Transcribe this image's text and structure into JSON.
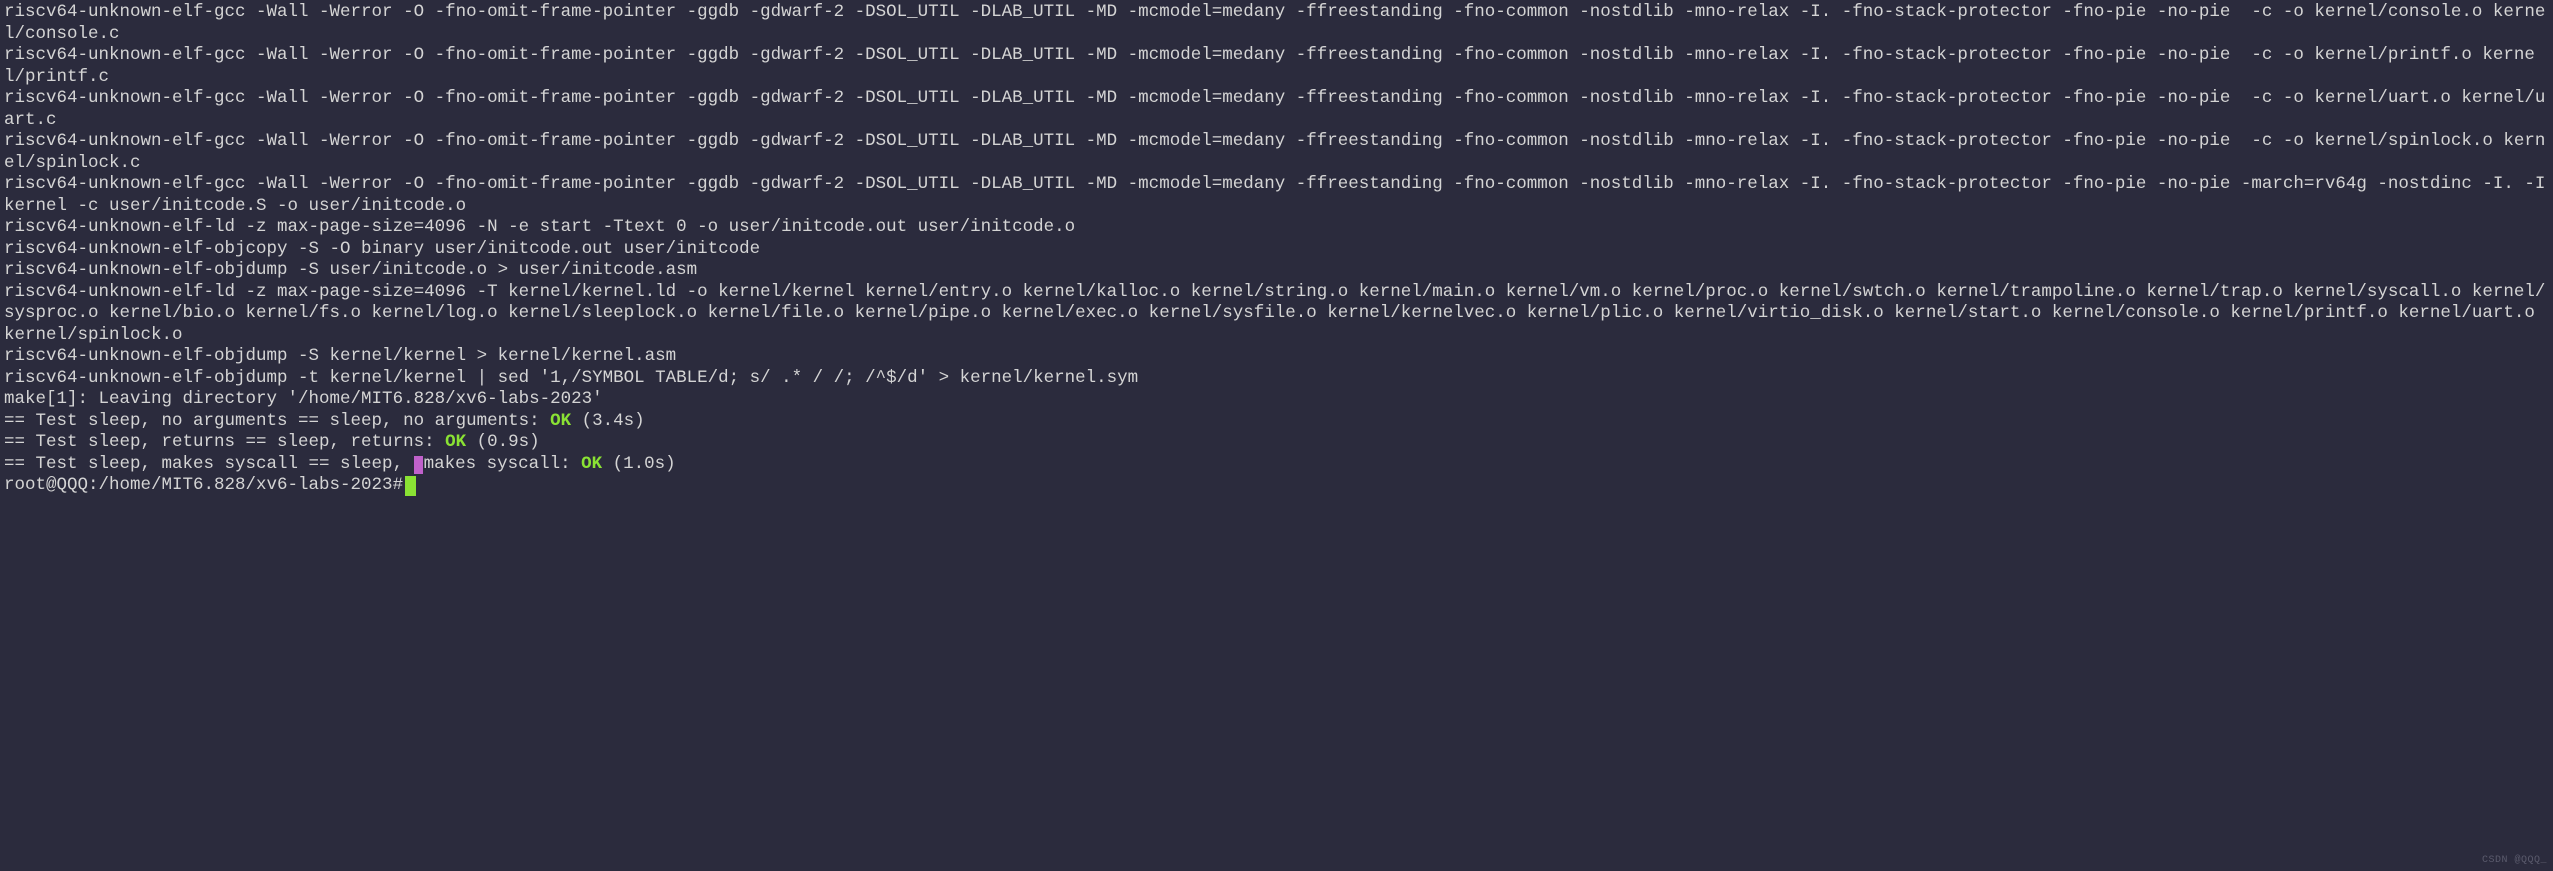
{
  "terminal": {
    "lines": {
      "compile_console": "riscv64-unknown-elf-gcc -Wall -Werror -O -fno-omit-frame-pointer -ggdb -gdwarf-2 -DSOL_UTIL -DLAB_UTIL -MD -mcmodel=medany -ffreestanding -fno-common -nostdlib -mno-relax -I. -fno-stack-protector -fno-pie -no-pie  -c -o kernel/console.o kernel/console.c",
      "compile_printf": "riscv64-unknown-elf-gcc -Wall -Werror -O -fno-omit-frame-pointer -ggdb -gdwarf-2 -DSOL_UTIL -DLAB_UTIL -MD -mcmodel=medany -ffreestanding -fno-common -nostdlib -mno-relax -I. -fno-stack-protector -fno-pie -no-pie  -c -o kernel/printf.o kernel/printf.c",
      "compile_uart": "riscv64-unknown-elf-gcc -Wall -Werror -O -fno-omit-frame-pointer -ggdb -gdwarf-2 -DSOL_UTIL -DLAB_UTIL -MD -mcmodel=medany -ffreestanding -fno-common -nostdlib -mno-relax -I. -fno-stack-protector -fno-pie -no-pie  -c -o kernel/uart.o kernel/uart.c",
      "compile_spinlock": "riscv64-unknown-elf-gcc -Wall -Werror -O -fno-omit-frame-pointer -ggdb -gdwarf-2 -DSOL_UTIL -DLAB_UTIL -MD -mcmodel=medany -ffreestanding -fno-common -nostdlib -mno-relax -I. -fno-stack-protector -fno-pie -no-pie  -c -o kernel/spinlock.o kernel/spinlock.c",
      "compile_initcode": "riscv64-unknown-elf-gcc -Wall -Werror -O -fno-omit-frame-pointer -ggdb -gdwarf-2 -DSOL_UTIL -DLAB_UTIL -MD -mcmodel=medany -ffreestanding -fno-common -nostdlib -mno-relax -I. -fno-stack-protector -fno-pie -no-pie -march=rv64g -nostdinc -I. -Ikernel -c user/initcode.S -o user/initcode.o",
      "ld_initcode": "riscv64-unknown-elf-ld -z max-page-size=4096 -N -e start -Ttext 0 -o user/initcode.out user/initcode.o",
      "objcopy_initcode": "riscv64-unknown-elf-objcopy -S -O binary user/initcode.out user/initcode",
      "objdump_initcode": "riscv64-unknown-elf-objdump -S user/initcode.o > user/initcode.asm",
      "ld_kernel": "riscv64-unknown-elf-ld -z max-page-size=4096 -T kernel/kernel.ld -o kernel/kernel kernel/entry.o kernel/kalloc.o kernel/string.o kernel/main.o kernel/vm.o kernel/proc.o kernel/swtch.o kernel/trampoline.o kernel/trap.o kernel/syscall.o kernel/sysproc.o kernel/bio.o kernel/fs.o kernel/log.o kernel/sleeplock.o kernel/file.o kernel/pipe.o kernel/exec.o kernel/sysfile.o kernel/kernelvec.o kernel/plic.o kernel/virtio_disk.o kernel/start.o kernel/console.o kernel/printf.o kernel/uart.o kernel/spinlock.o ",
      "objdump_kernel": "riscv64-unknown-elf-objdump -S kernel/kernel > kernel/kernel.asm",
      "objdump_sym": "riscv64-unknown-elf-objdump -t kernel/kernel | sed '1,/SYMBOL TABLE/d; s/ .* / /; /^$/d' > kernel/kernel.sym",
      "make_leaving": "make[1]: Leaving directory '/home/MIT6.828/xv6-labs-2023'",
      "test1_prefix": "== Test sleep, no arguments == sleep, no arguments: ",
      "test1_ok": "OK",
      "test1_time": " (3.4s)",
      "test2_prefix": "== Test sleep, returns == sleep, returns: ",
      "test2_ok": "OK",
      "test2_time": " (0.9s)",
      "test3_prefix": "== Test sleep, makes syscall == sleep, ",
      "test3_mid": "makes syscall: ",
      "test3_ok": "OK",
      "test3_time": " (1.0s)",
      "prompt": "root@QQQ:/home/MIT6.828/xv6-labs-2023# "
    },
    "watermark": "CSDN @QQQ_"
  }
}
